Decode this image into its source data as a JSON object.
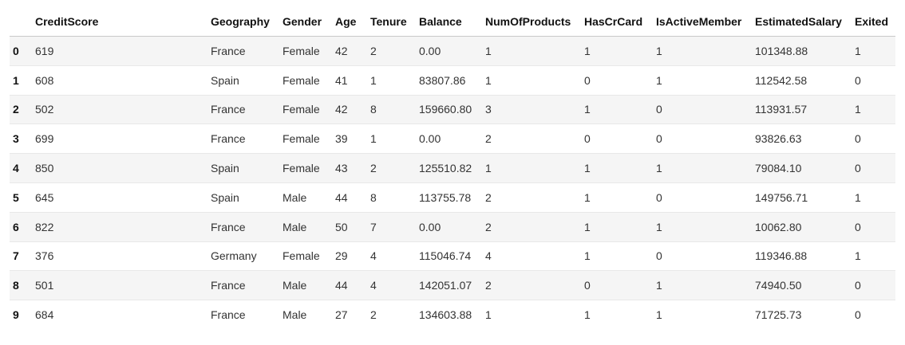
{
  "table": {
    "columns": [
      "",
      "CreditScore",
      "Geography",
      "Gender",
      "Age",
      "Tenure",
      "Balance",
      "NumOfProducts",
      "HasCrCard",
      "IsActiveMember",
      "EstimatedSalary",
      "Exited"
    ],
    "rows": [
      [
        "0",
        "619",
        "France",
        "Female",
        "42",
        "2",
        "0.00",
        "1",
        "1",
        "1",
        "101348.88",
        "1"
      ],
      [
        "1",
        "608",
        "Spain",
        "Female",
        "41",
        "1",
        "83807.86",
        "1",
        "0",
        "1",
        "112542.58",
        "0"
      ],
      [
        "2",
        "502",
        "France",
        "Female",
        "42",
        "8",
        "159660.80",
        "3",
        "1",
        "0",
        "113931.57",
        "1"
      ],
      [
        "3",
        "699",
        "France",
        "Female",
        "39",
        "1",
        "0.00",
        "2",
        "0",
        "0",
        "93826.63",
        "0"
      ],
      [
        "4",
        "850",
        "Spain",
        "Female",
        "43",
        "2",
        "125510.82",
        "1",
        "1",
        "1",
        "79084.10",
        "0"
      ],
      [
        "5",
        "645",
        "Spain",
        "Male",
        "44",
        "8",
        "113755.78",
        "2",
        "1",
        "0",
        "149756.71",
        "1"
      ],
      [
        "6",
        "822",
        "France",
        "Male",
        "50",
        "7",
        "0.00",
        "2",
        "1",
        "1",
        "10062.80",
        "0"
      ],
      [
        "7",
        "376",
        "Germany",
        "Female",
        "29",
        "4",
        "115046.74",
        "4",
        "1",
        "0",
        "119346.88",
        "1"
      ],
      [
        "8",
        "501",
        "France",
        "Male",
        "44",
        "4",
        "142051.07",
        "2",
        "0",
        "1",
        "74940.50",
        "0"
      ],
      [
        "9",
        "684",
        "France",
        "Male",
        "27",
        "2",
        "134603.88",
        "1",
        "1",
        "1",
        "71725.73",
        "0"
      ]
    ]
  }
}
